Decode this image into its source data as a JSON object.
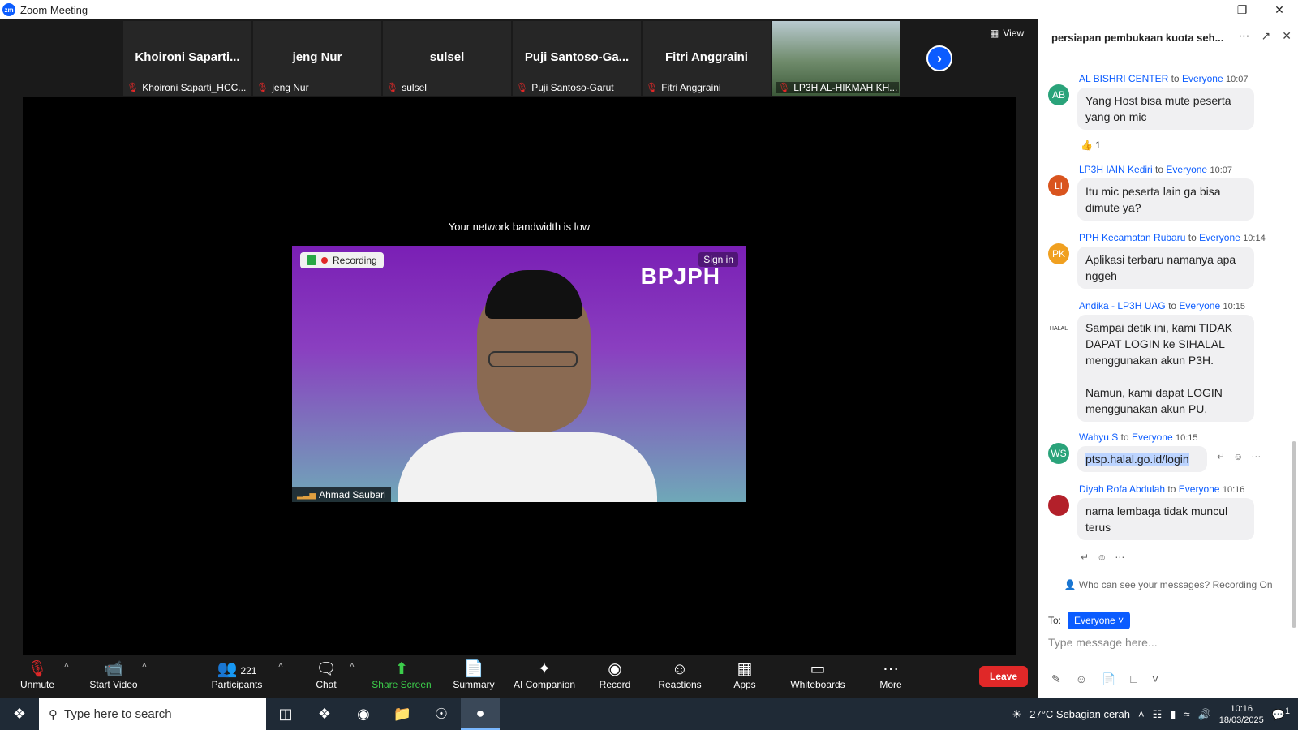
{
  "window": {
    "title": "Zoom Meeting",
    "app_icon": "zm"
  },
  "stage": {
    "view_label": "View",
    "participants": [
      {
        "big": "Khoironi  Saparti...",
        "small": "Khoironi Saparti_HCC..."
      },
      {
        "big": "jeng Nur",
        "small": "jeng Nur"
      },
      {
        "big": "sulsel",
        "small": "sulsel"
      },
      {
        "big": "Puji  Santoso-Ga...",
        "small": "Puji Santoso-Garut"
      },
      {
        "big": "Fitri Anggraini",
        "small": "Fitri Anggraini"
      },
      {
        "big": "",
        "small": "LP3H AL-HIKMAH KH..."
      }
    ],
    "bandwidth_notice": "Your network bandwidth is low",
    "recording_label": "Recording",
    "signin_label": "Sign in",
    "logo_text": "BPJPH",
    "speaker_name": "Ahmad Saubari"
  },
  "toolbar": {
    "unmute": "Unmute",
    "start_video": "Start Video",
    "participants": "Participants",
    "participant_count": "221",
    "chat": "Chat",
    "share_screen": "Share Screen",
    "summary": "Summary",
    "ai_companion": "AI Companion",
    "record": "Record",
    "reactions": "Reactions",
    "apps": "Apps",
    "whiteboards": "Whiteboards",
    "more": "More",
    "leave": "Leave"
  },
  "chat": {
    "title": "persiapan pembukaan kuota seh...",
    "messages": [
      {
        "initials": "AB",
        "color": "#2aa37a",
        "sender": "AL BISHRI CENTER",
        "to": "to",
        "recipient": "Everyone",
        "time": "10:07",
        "text": "Yang Host bisa mute peserta yang on mic"
      },
      {
        "initials": "LI",
        "color": "#d9541e",
        "sender": "LP3H IAIN Kediri",
        "to": "to",
        "recipient": "Everyone",
        "time": "10:07",
        "text": "Itu mic peserta lain ga bisa dimute ya?"
      },
      {
        "initials": "PK",
        "color": "#f0a020",
        "sender": "PPH Kecamatan Rubaru",
        "to": "to",
        "recipient": "Everyone",
        "time": "10:14",
        "text": "Aplikasi terbaru namanya apa nggeh"
      },
      {
        "initials": "HALAL",
        "color": "#ffffff",
        "sender": "Andika - LP3H UAG",
        "to": "to",
        "recipient": "Everyone",
        "time": "10:15",
        "text": "Sampai detik ini, kami TIDAK DAPAT LOGIN ke SIHALAL menggunakan akun P3H.\n\nNamun, kami dapat LOGIN menggunakan akun PU."
      },
      {
        "initials": "WS",
        "color": "#2aa37a",
        "sender": "Wahyu S",
        "to": "to",
        "recipient": "Everyone",
        "time": "10:15",
        "text": "ptsp.halal.go.id/login"
      },
      {
        "initials": "",
        "color": "#b3202a",
        "sender": "Diyah Rofa Abdulah",
        "to": "to",
        "recipient": "Everyone",
        "time": "10:16",
        "text": "nama lembaga tidak muncul terus"
      }
    ],
    "reaction_count": "1",
    "privacy_notice": "Who can see your messages? Recording On",
    "to_label": "To:",
    "to_value": "Everyone",
    "input_placeholder": "Type message here..."
  },
  "taskbar": {
    "search_placeholder": "Type here to search",
    "weather": "27°C  Sebagian cerah",
    "time": "10:16",
    "date": "18/03/2025",
    "notification_count": "1"
  }
}
